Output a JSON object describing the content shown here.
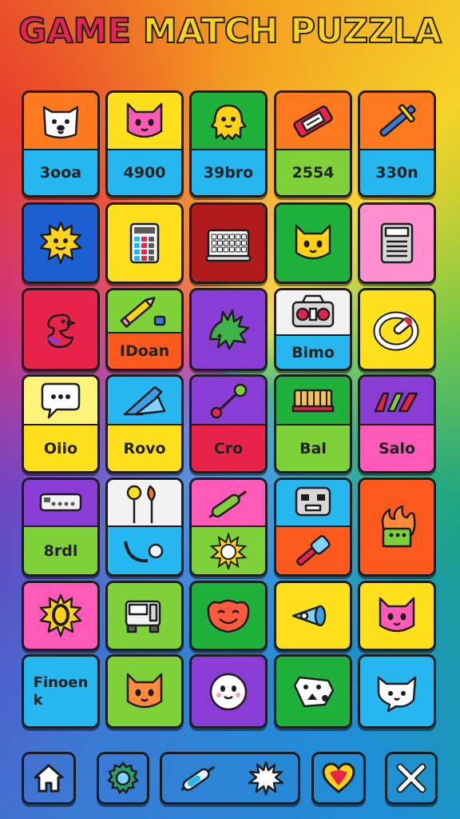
{
  "title": {
    "part1": "GAME",
    "part2": "MATCH PUZZLA"
  },
  "tiles": [
    {
      "icon": "dog-face-icon",
      "top": "#ff7a1e",
      "bottom": "#27b7f0",
      "label": "3ooa"
    },
    {
      "icon": "cat-face-icon",
      "top": "#ffe01c",
      "bottom": "#27b7f0",
      "label": "4900"
    },
    {
      "icon": "blob-creature-icon",
      "top": "#1fb13b",
      "bottom": "#27b7f0",
      "label": "39bro"
    },
    {
      "icon": "candy-bar-icon",
      "top": "#ff7a1e",
      "bottom": "#7fd13a",
      "label": "2554"
    },
    {
      "icon": "sword-icon",
      "top": "#ff7a1e",
      "bottom": "#27b7f0",
      "label": "330n"
    },
    {
      "icon": "sun-face-icon",
      "top": "#1c5fd0",
      "bottom": null,
      "label": null
    },
    {
      "icon": "calculator-icon",
      "top": "#ffe01c",
      "bottom": null,
      "label": null
    },
    {
      "icon": "keyboard-icon",
      "top": "#b21b1b",
      "bottom": null,
      "label": null
    },
    {
      "icon": "cat-face-icon",
      "top": "#1fb13b",
      "bottom": null,
      "label": null
    },
    {
      "icon": "receipt-machine-icon",
      "top": "#ff8fd0",
      "bottom": null,
      "label": null
    },
    {
      "icon": "bird-icon",
      "top": "#e8244b",
      "bottom": null,
      "label": null
    },
    {
      "icon": "pencil-icon",
      "top": "#7fd13a",
      "bottom": "#ff5a1e",
      "label": "IDoan"
    },
    {
      "icon": "leaf-creature-icon",
      "top": "#8a3dd4",
      "bottom": null,
      "label": null
    },
    {
      "icon": "radio-icon",
      "top": "#f2f2f2",
      "bottom": "#27b7f0",
      "label": "Bimo"
    },
    {
      "icon": "ring-icon",
      "top": "#ffe01c",
      "bottom": null,
      "label": null
    },
    {
      "icon": "speech-bubble-icon",
      "top": "#fff27a",
      "bottom": "#ffe01c",
      "label": "Oiio"
    },
    {
      "icon": "wedge-icon",
      "top": "#27b7f0",
      "bottom": "#ffe01c",
      "label": "Rovo"
    },
    {
      "icon": "pin-icon",
      "top": "#8a3dd4",
      "bottom": "#e8244b",
      "label": "Cro"
    },
    {
      "icon": "bench-icon",
      "top": "#1fb13b",
      "bottom": "#7fd13a",
      "label": "Bal"
    },
    {
      "icon": "zigzag-icon",
      "top": "#8a3dd4",
      "bottom": "#ff5ab8",
      "label": "Salo"
    },
    {
      "icon": "remote-icon",
      "top": "#8a3dd4",
      "bottom": "#7fd13a",
      "label": "8rdl"
    },
    {
      "icon": "balloons-icon",
      "top": "#f2f2f2",
      "bottom": "#27b7f0",
      "label": null
    },
    {
      "icon": "syringe-icon",
      "top": "#ff5ab8",
      "bottom": "#7fd13a",
      "label": null
    },
    {
      "icon": "robot-face-icon",
      "top": "#27b7f0",
      "bottom": "#ff5a1e",
      "label": null
    },
    {
      "icon": "flame-hand-icon",
      "top": "#ff5a1e",
      "bottom": null,
      "label": null
    },
    {
      "icon": "sun-ring-icon",
      "top": "#ff5ab8",
      "bottom": null,
      "label": null
    },
    {
      "icon": "machine-icon",
      "top": "#7fd13a",
      "bottom": null,
      "label": null
    },
    {
      "icon": "smile-face-icon",
      "top": "#1fb13b",
      "bottom": null,
      "label": null
    },
    {
      "icon": "horn-icon",
      "top": "#ffe01c",
      "bottom": null,
      "label": null
    },
    {
      "icon": "cat-face-icon",
      "top": "#ffe01c",
      "bottom": null,
      "label": null
    },
    {
      "icon": "text-tile-icon",
      "top": "#27b7f0",
      "bottom": null,
      "label": "Finoen\nk"
    },
    {
      "icon": "cat-face-icon",
      "top": "#7fd13a",
      "bottom": null,
      "label": null
    },
    {
      "icon": "ghost-face-icon",
      "top": "#8a3dd4",
      "bottom": null,
      "label": null
    },
    {
      "icon": "cow-icon",
      "top": "#1fb13b",
      "bottom": null,
      "label": null
    },
    {
      "icon": "cat-bubble-icon",
      "top": "#27b7f0",
      "bottom": null,
      "label": null
    }
  ],
  "buttons": {
    "home": {
      "icon": "home-icon",
      "color": "#27b7f0"
    },
    "settings": {
      "icon": "gear-icon",
      "color": "#bdbdbd"
    },
    "powerup": {
      "icon": "syringe-icon",
      "icon2": "star-burst-icon",
      "color": "#7fd13a"
    },
    "heart": {
      "icon": "heart-icon",
      "color": "#c7c7c7"
    },
    "close": {
      "icon": "close-icon",
      "color": "#5a7cc4"
    }
  }
}
